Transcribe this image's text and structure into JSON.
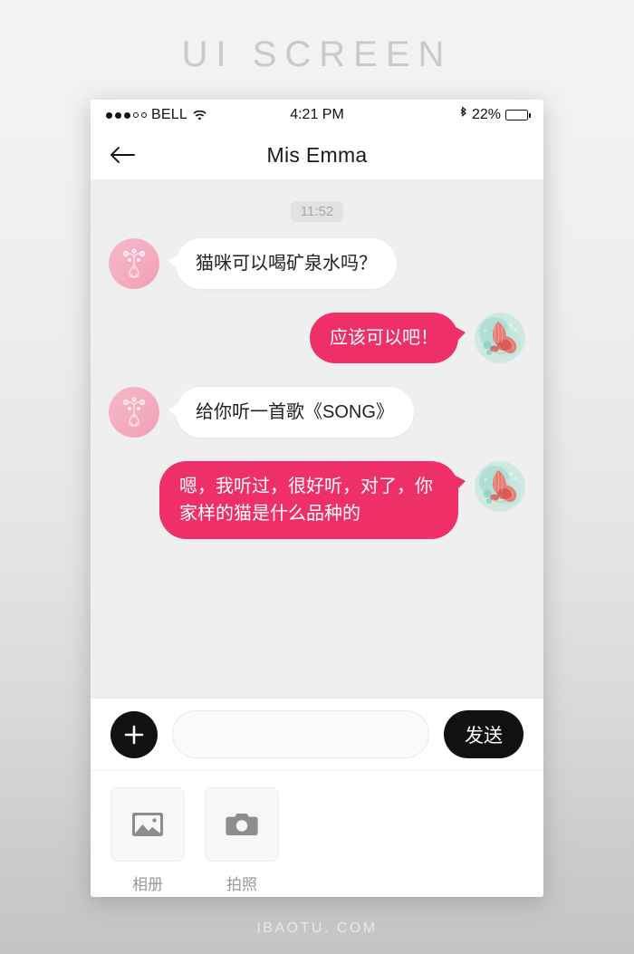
{
  "page": {
    "header_title": "UI SCREEN",
    "footer_text": "IBAOTU. COM"
  },
  "statusbar": {
    "carrier": "BELL",
    "signal_dots_filled": 3,
    "signal_dots_total": 5,
    "wifi_icon": "wifi-icon",
    "time": "4:21 PM",
    "bluetooth_icon": "bluetooth-icon",
    "battery_percent": "22%",
    "battery_level": 22
  },
  "navbar": {
    "back_icon": "back-arrow-icon",
    "title": "Mis Emma"
  },
  "chat": {
    "timestamp": "11:52",
    "messages": [
      {
        "id": "msg-1",
        "side": "in",
        "text": "猫咪可以喝矿泉水吗？",
        "avatar": "contact-avatar"
      },
      {
        "id": "msg-2",
        "side": "out",
        "text": "应该可以吧！",
        "avatar": "user-avatar"
      },
      {
        "id": "msg-3",
        "side": "in",
        "text": "给你听一首歌《SONG》",
        "avatar": "contact-avatar"
      },
      {
        "id": "msg-4",
        "side": "out",
        "text": "嗯，我听过，很好听，对了，你家样的猫是什么品种的",
        "avatar": "user-avatar"
      }
    ]
  },
  "inputbar": {
    "plus_icon": "plus-icon",
    "input_value": "",
    "input_placeholder": "",
    "send_label": "发送"
  },
  "attachments": [
    {
      "icon": "photo-library-icon",
      "label": "相册"
    },
    {
      "icon": "camera-icon",
      "label": "拍照"
    }
  ],
  "colors": {
    "accent_pink": "#ee2f68",
    "dark": "#111111",
    "chat_bg": "#efefef",
    "bubble_in": "#ffffff"
  }
}
